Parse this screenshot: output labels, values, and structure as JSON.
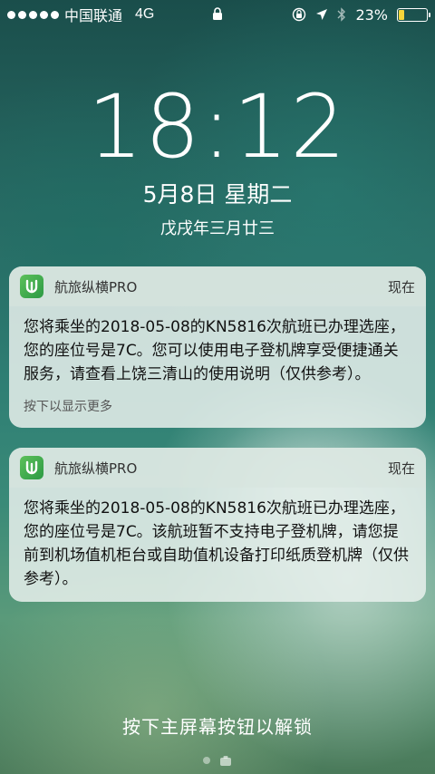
{
  "status_bar": {
    "carrier": "中国联通",
    "network": "4G",
    "battery": "23%",
    "battery_level": 0.23,
    "signal_dots": 5
  },
  "lockscreen": {
    "time": "18:12",
    "date": "5月8日 星期二",
    "lunar_date": "戊戌年三月廿三"
  },
  "notifications": [
    {
      "app_name": "航旅纵横PRO",
      "time": "现在",
      "body": "您将乘坐的2018-05-08的KN5816次航班已办理选座，您的座位号是7C。您可以使用电子登机牌享受便捷通关服务，请查看上饶三清山的使用说明（仅供参考）。",
      "more": "按下以显示更多"
    },
    {
      "app_name": "航旅纵横PRO",
      "time": "现在",
      "body": "您将乘坐的2018-05-08的KN5816次航班已办理选座，您的座位号是7C。该航班暂不支持电子登机牌，请您提前到机场值机柜台或自助值机设备打印纸质登机牌（仅供参考）。"
    }
  ],
  "unlock_hint": "按下主屏幕按钮以解锁",
  "colors": {
    "battery_fill": "#f5d53a",
    "app_icon": "#3aaa4a"
  }
}
